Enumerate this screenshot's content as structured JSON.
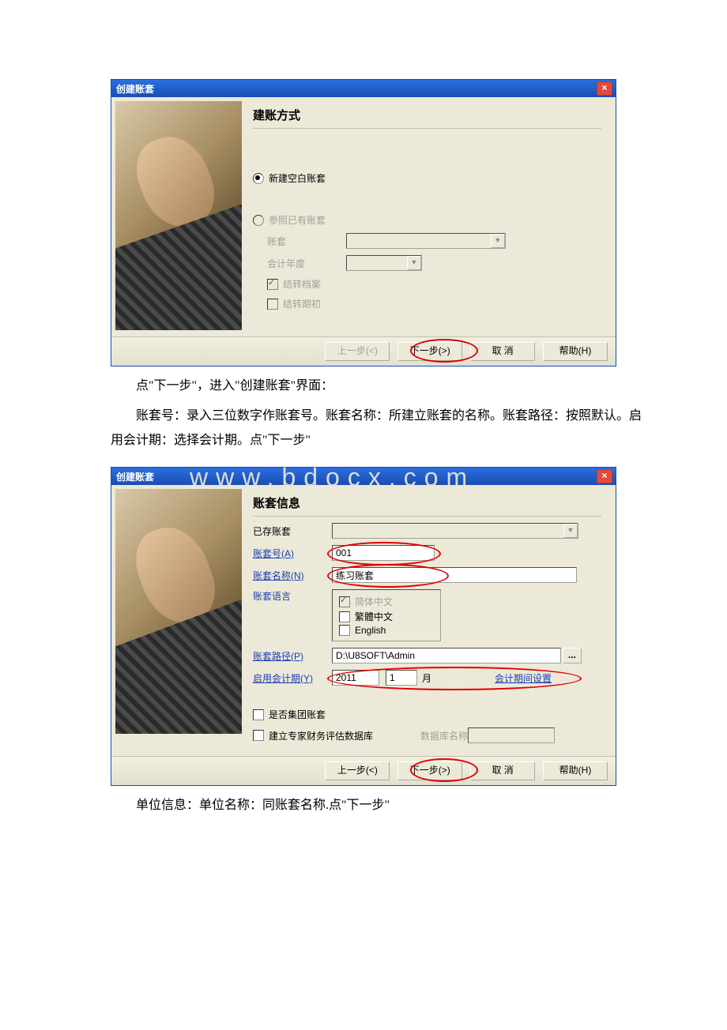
{
  "dialog1": {
    "title": "创建账套",
    "heading": "建账方式",
    "radio_new_blank": "新建空白账套",
    "radio_ref_existing": "参照已有账套",
    "label_account": "账套",
    "label_fiscal_year": "会计年度",
    "chk_carry_archive": "结转档案",
    "chk_carry_opening": "结转期初",
    "btn_prev": "上一步(<)",
    "btn_next": "下一步(>)",
    "btn_cancel": "取 消",
    "btn_help": "帮助(H)"
  },
  "para1": "点\"下一步\"，进入\"创建账套\"界面：",
  "para2": "账套号：录入三位数字作账套号。账套名称：所建立账套的名称。账套路径：按照默认。启用会计期：选择会计期。点\"下一步\"",
  "dialog2": {
    "title": "创建账套",
    "heading": "账套信息",
    "label_existing": "已存账套",
    "label_account_no": "账套号(A)",
    "value_account_no": "001",
    "label_account_name": "账套名称(N)",
    "value_account_name": "练习账套",
    "label_lang": "账套语言",
    "lang_zh_cn": "简体中文",
    "lang_zh_tw": "繁體中文",
    "lang_en": "English",
    "label_path": "账套路径(P)",
    "value_path": "D:\\U8SOFT\\Admin",
    "label_start_period": "启用会计期(Y)",
    "value_year": "2011",
    "value_month": "1",
    "month_suffix": "月",
    "period_setting": "会计期间设置",
    "chk_group": "是否集团账套",
    "chk_expert_db": "建立专家财务评估数据库",
    "label_db_name": "数据库名称",
    "btn_prev": "上一步(<)",
    "btn_next": "下一步(>)",
    "btn_cancel": "取 消",
    "btn_help": "帮助(H)"
  },
  "para3": "单位信息：单位名称：同账套名称.点\"下一步\""
}
